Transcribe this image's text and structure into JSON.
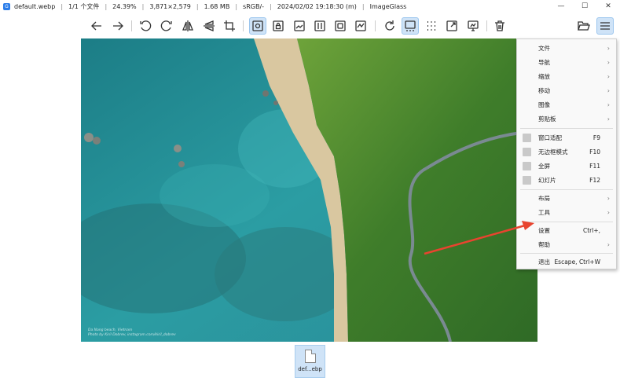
{
  "titlebar": {
    "filename": "default.webp",
    "file_index": "1/1 个文件",
    "zoom": "24.39%",
    "dimensions": "3,871×2,579",
    "filesize": "1.68 MB",
    "colorspace": "sRGB/-",
    "datetime": "2024/02/02 19:18:30 (m)",
    "app_name": "ImageGlass"
  },
  "window_controls": {
    "minimize": "—",
    "maximize": "☐",
    "close": "✕"
  },
  "image": {
    "credit_line1": "Da Nang beach, Vietnam",
    "credit_line2": "Photo by Kiril Dobrev, instagram.com/kiril_dobrev"
  },
  "thumbnail": {
    "label": "def...ebp"
  },
  "menu": {
    "file": "文件",
    "navigation": "导航",
    "zoom": "缩放",
    "move": "移动",
    "image": "图像",
    "clipboard": "剪贴板",
    "window_fit": "窗口适配",
    "window_fit_key": "F9",
    "frameless": "无边框模式",
    "frameless_key": "F10",
    "fullscreen": "全屏",
    "fullscreen_key": "F11",
    "slideshow": "幻灯片",
    "slideshow_key": "F12",
    "layout": "布局",
    "tools": "工具",
    "settings": "设置",
    "settings_key": "Ctrl+,",
    "help": "帮助",
    "exit": "退出",
    "exit_key": "Escape, Ctrl+W"
  },
  "colors": {
    "accent": "#cfe3f7",
    "annotation_arrow": "#e8442f"
  }
}
